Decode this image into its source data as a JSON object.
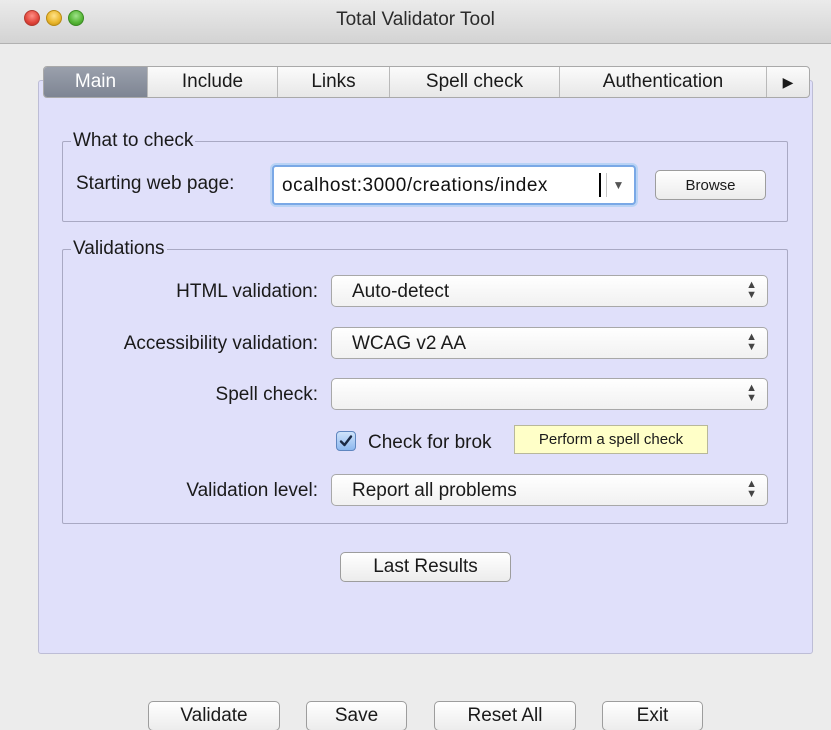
{
  "window": {
    "title": "Total Validator Tool"
  },
  "tabs": [
    {
      "label": "Main",
      "active": true
    },
    {
      "label": "Include",
      "active": false
    },
    {
      "label": "Links",
      "active": false
    },
    {
      "label": "Spell check",
      "active": false
    },
    {
      "label": "Authentication",
      "active": false
    }
  ],
  "tabs_more_icon": "triangle-right-icon",
  "what_to_check": {
    "legend": "What to check",
    "starting_page_label": "Starting web page:",
    "starting_page_value": "ocalhost:3000/creations/index",
    "browse_label": "Browse"
  },
  "validations": {
    "legend": "Validations",
    "html_label": "HTML validation:",
    "html_value": "Auto-detect",
    "accessibility_label": "Accessibility validation:",
    "accessibility_value": "WCAG v2 AA",
    "spell_label": "Spell check:",
    "spell_value": "",
    "broken_links_label": "Check for brok",
    "broken_links_checked": true,
    "level_label": "Validation level:",
    "level_value": "Report all problems"
  },
  "tooltip": "Perform a spell check",
  "last_results_label": "Last Results",
  "footer": {
    "validate_label": "Validate",
    "save_label": "Save",
    "reset_label": "Reset All",
    "exit_label": "Exit"
  },
  "colors": {
    "panel_bg": "#e0e0fa",
    "tooltip_bg": "#ffffc8",
    "focus_ring": "#7aa8e6"
  }
}
